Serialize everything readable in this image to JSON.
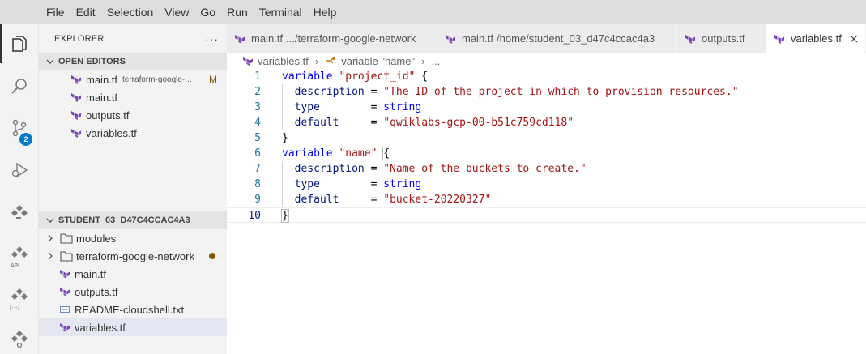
{
  "menu": [
    "File",
    "Edit",
    "Selection",
    "View",
    "Go",
    "Run",
    "Terminal",
    "Help"
  ],
  "activity_bar": {
    "source_control_badge": "2",
    "api_label": "API",
    "bracket_label": "[···]"
  },
  "explorer": {
    "title": "EXPLORER",
    "more": "···",
    "open_editors": {
      "title": "OPEN EDITORS",
      "items": [
        {
          "name": "main.tf",
          "sub": "terraform-google-...",
          "status": "M"
        },
        {
          "name": "main.tf",
          "sub": "",
          "status": ""
        },
        {
          "name": "outputs.tf",
          "sub": "",
          "status": ""
        },
        {
          "name": "variables.tf",
          "sub": "",
          "status": ""
        }
      ]
    },
    "workspace": {
      "title": "STUDENT_03_D47C4CCAC4A3",
      "items": [
        {
          "name": "modules",
          "type": "folder"
        },
        {
          "name": "terraform-google-network",
          "type": "folder"
        },
        {
          "name": "main.tf",
          "type": "tf"
        },
        {
          "name": "outputs.tf",
          "type": "tf"
        },
        {
          "name": "README-cloudshell.txt",
          "type": "txt"
        },
        {
          "name": "variables.tf",
          "type": "tf"
        }
      ]
    }
  },
  "tabs": [
    {
      "label": "main.tf",
      "desc": ".../terraform-google-network"
    },
    {
      "label": "main.tf",
      "desc": "/home/student_03_d47c4ccac4a3"
    },
    {
      "label": "outputs.tf",
      "desc": ""
    },
    {
      "label": "variables.tf",
      "desc": ""
    }
  ],
  "breadcrumb": {
    "file": "variables.tf",
    "symbol": "variable \"name\"",
    "more": "..."
  },
  "editor": {
    "line_numbers": [
      "1",
      "2",
      "3",
      "4",
      "5",
      "6",
      "7",
      "8",
      "9",
      "10"
    ],
    "lines": [
      [
        {
          "t": "variable ",
          "c": "kw"
        },
        {
          "t": "\"project_id\"",
          "c": "str"
        },
        {
          "t": " {",
          "c": "plain"
        }
      ],
      [
        {
          "t": "  description",
          "c": "attr"
        },
        {
          "t": " = ",
          "c": "plain"
        },
        {
          "t": "\"The ID of the project in which to provision resources.\"",
          "c": "str"
        }
      ],
      [
        {
          "t": "  type",
          "c": "attr"
        },
        {
          "t": "        = ",
          "c": "plain"
        },
        {
          "t": "string",
          "c": "kw"
        }
      ],
      [
        {
          "t": "  default",
          "c": "attr"
        },
        {
          "t": "     = ",
          "c": "plain"
        },
        {
          "t": "\"qwiklabs-gcp-00-b51c759cd118\"",
          "c": "str"
        }
      ],
      [
        {
          "t": "}",
          "c": "plain"
        }
      ],
      [
        {
          "t": "variable ",
          "c": "kw"
        },
        {
          "t": "\"name\"",
          "c": "str"
        },
        {
          "t": " ",
          "c": "plain"
        },
        {
          "t": "{",
          "c": "plain bracket-box"
        }
      ],
      [
        {
          "t": "  description",
          "c": "attr"
        },
        {
          "t": " = ",
          "c": "plain"
        },
        {
          "t": "\"Name of the buckets to create.\"",
          "c": "str"
        }
      ],
      [
        {
          "t": "  type",
          "c": "attr"
        },
        {
          "t": "        = ",
          "c": "plain"
        },
        {
          "t": "string",
          "c": "kw"
        }
      ],
      [
        {
          "t": "  default",
          "c": "attr"
        },
        {
          "t": "     = ",
          "c": "plain"
        },
        {
          "t": "\"bucket-20220327\"",
          "c": "str"
        }
      ],
      [
        {
          "t": "}",
          "c": "plain bracket-box"
        }
      ]
    ],
    "current_line": 10
  },
  "colors": {
    "terraform_icon": "#7b42bc",
    "modified": "#895503",
    "badge": "#007acc"
  }
}
